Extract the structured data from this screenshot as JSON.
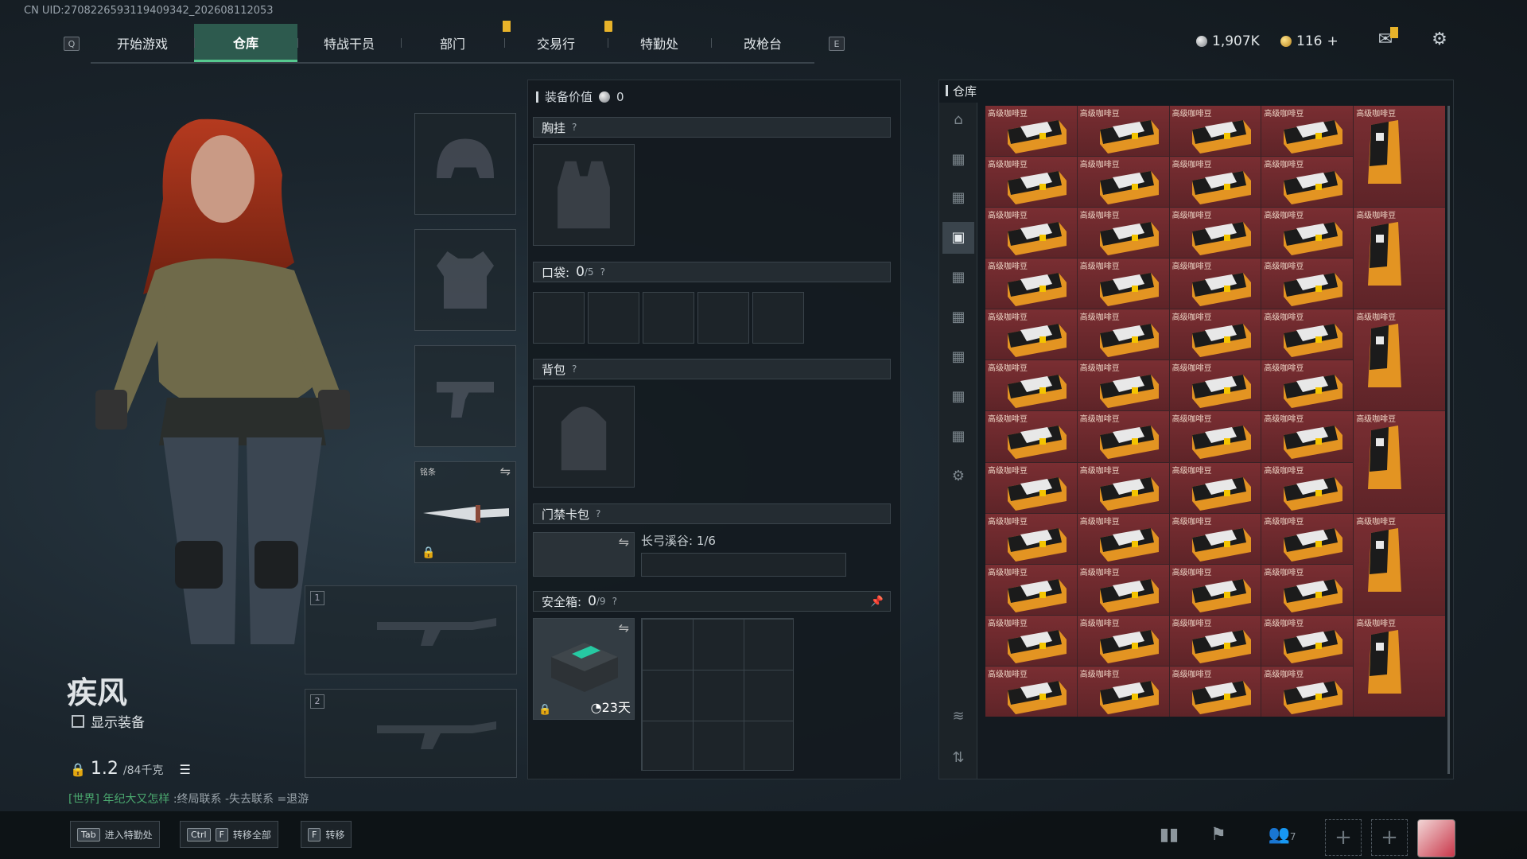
{
  "uid": "CN UID:2708226593119409342_202608112053",
  "nav": {
    "left_key": "Q",
    "right_key": "E",
    "tabs": [
      "开始游戏",
      "仓库",
      "特战干员",
      "部门",
      "交易行",
      "特勤处",
      "改枪台"
    ],
    "active_tab": "仓库"
  },
  "currency": {
    "silver": "1,907K",
    "gold": "116",
    "plus": "+"
  },
  "character": {
    "name": "疾风",
    "show_equipment_label": "显示装备",
    "weight_value": "1.2",
    "weight_max": "/84千克",
    "melee_label": "铭条",
    "weapon_slot_1": "1",
    "weapon_slot_2": "2"
  },
  "chat": {
    "channel": "[世界]",
    "user": "年纪大又怎样",
    "message": ":终局联系 -失去联系 =退游"
  },
  "equipment": {
    "value_label": "装备价值",
    "value": "0",
    "chest_rig": "胸挂",
    "pocket_label": "口袋:",
    "pocket_count": "0",
    "pocket_max": "/5",
    "backpack": "背包",
    "keycard": "门禁卡包",
    "keycard_location": "长弓溪谷: 1/6",
    "safebox_label": "安全箱:",
    "safebox_count": "0",
    "safebox_max": "/9",
    "safebox_days": "23天",
    "help": "?"
  },
  "inventory": {
    "title": "仓库",
    "item_name": "高级咖啡豆",
    "rows": 12,
    "cols_small": 4
  },
  "bottom": {
    "enter_key": "Tab",
    "enter_label": "进入特勤处",
    "transfer_all_keys": [
      "Ctrl",
      "F"
    ],
    "transfer_all_label": "转移全部",
    "transfer_key": "F",
    "transfer_label": "转移",
    "friends_count": "7",
    "plus": "+"
  },
  "colors": {
    "accent": "#56c98f",
    "active_tab_bg": "#2d5a4e",
    "item_bg": "#7a2e32",
    "badge": "#e8b32a"
  }
}
